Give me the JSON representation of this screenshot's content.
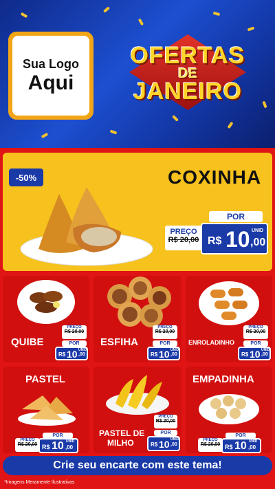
{
  "logo": {
    "line1": "Sua Logo",
    "line2": "Aqui"
  },
  "banner": {
    "line1": "OFERTAS",
    "line2": "DE",
    "line3": "JANEIRO"
  },
  "hero": {
    "discount": "-50%",
    "title": "COXINHA",
    "por": "POR",
    "preco": "PREÇO",
    "old_price": "R$ 20,00",
    "currency": "R$",
    "price_int": "10",
    "price_cents": ",00",
    "unit": "UNID"
  },
  "products": [
    {
      "name": "QUIBE",
      "preco": "PREÇO",
      "old": "R$ 20,00",
      "por": "POR",
      "currency": "R$",
      "int": "10",
      "cents": ",00",
      "unit": "UNID"
    },
    {
      "name": "ESFIHA",
      "preco": "PREÇO",
      "old": "R$ 20,00",
      "por": "POR",
      "currency": "R$",
      "int": "10",
      "cents": ",00",
      "unit": "UNID"
    },
    {
      "name": "ENROLADINHO",
      "preco": "PREÇO",
      "old": "R$ 20,00",
      "por": "POR",
      "currency": "R$",
      "int": "10",
      "cents": ",00",
      "unit": "UNID"
    },
    {
      "name": "PASTEL",
      "preco": "PREÇO",
      "old": "R$ 20,00",
      "por": "POR",
      "currency": "R$",
      "int": "10",
      "cents": ",00",
      "unit": "UNID"
    },
    {
      "name": "PASTEL DE MILHO",
      "line1": "PASTEL DE",
      "line2": "MILHO",
      "preco": "PREÇO",
      "old": "R$ 20,00",
      "por": "POR",
      "currency": "R$",
      "int": "10",
      "cents": ",00",
      "unit": "UNID"
    },
    {
      "name": "EMPADINHA",
      "preco": "PREÇO",
      "old": "R$ 20,00",
      "por": "POR",
      "currency": "R$",
      "int": "10",
      "cents": ",00",
      "unit": "UNID"
    }
  ],
  "cta": "Crie seu encarte com este tema!",
  "note": "*Imagens Meramente Ilustrativas",
  "colors": {
    "blue": "#1a3aa8",
    "red": "#e01414",
    "yellow": "#f7c21d"
  }
}
